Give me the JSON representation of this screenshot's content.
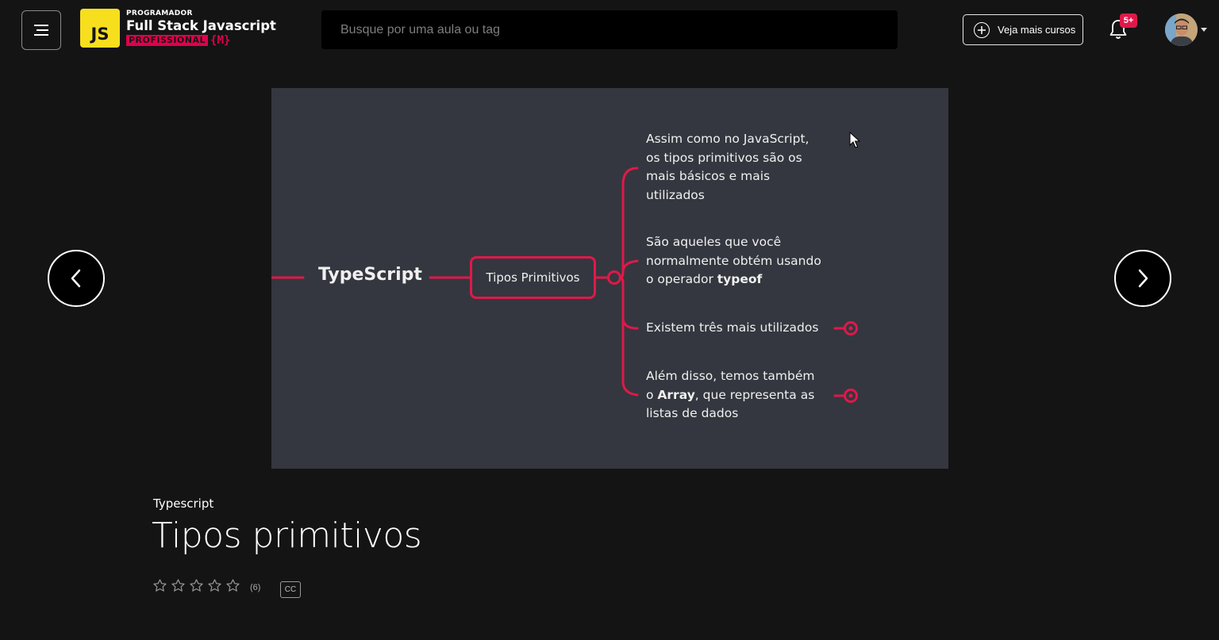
{
  "header": {
    "logo": {
      "badge": "JS",
      "top_line": "PROGRAMADOR",
      "main_line": "Full Stack Javascript",
      "bottom_line": "PROFISSIONAL",
      "brace": "{M}"
    },
    "search_placeholder": "Busque por uma aula ou tag",
    "more_courses_label": "Veja mais cursos",
    "notifications_badge": "5+",
    "icons": [
      "hamburger-menu-icon",
      "plus-circle-icon",
      "bell-icon",
      "avatar",
      "chevron-down-icon"
    ]
  },
  "slide": {
    "root": "TypeScript",
    "node": "Tipos Primitivos",
    "branches": [
      {
        "lines": [
          "Assim como no JavaScript,",
          "os tipos primitivos são os",
          "mais básicos e mais",
          "utilizados"
        ]
      },
      {
        "lines": [
          "São aqueles que você",
          "normalmente obtém usando"
        ],
        "last_prefix": "o operador ",
        "last_bold": "typeof"
      },
      {
        "lines": [
          "Existem três mais utilizados"
        ]
      },
      {
        "line1": "Além disso, temos também",
        "line2_prefix": "o ",
        "line2_bold": "Array",
        "line2_suffix": ", que representa as",
        "line3": "listas de dados"
      }
    ]
  },
  "lesson": {
    "course": "Typescript",
    "title": "Tipos primitivos",
    "rating_count": "(6)",
    "stars": 0,
    "cc_label": "CC"
  },
  "colors": {
    "accent": "#e0184a",
    "logo_yellow": "#f7df1e",
    "background": "#141414",
    "slide_bg": "#34373f"
  }
}
